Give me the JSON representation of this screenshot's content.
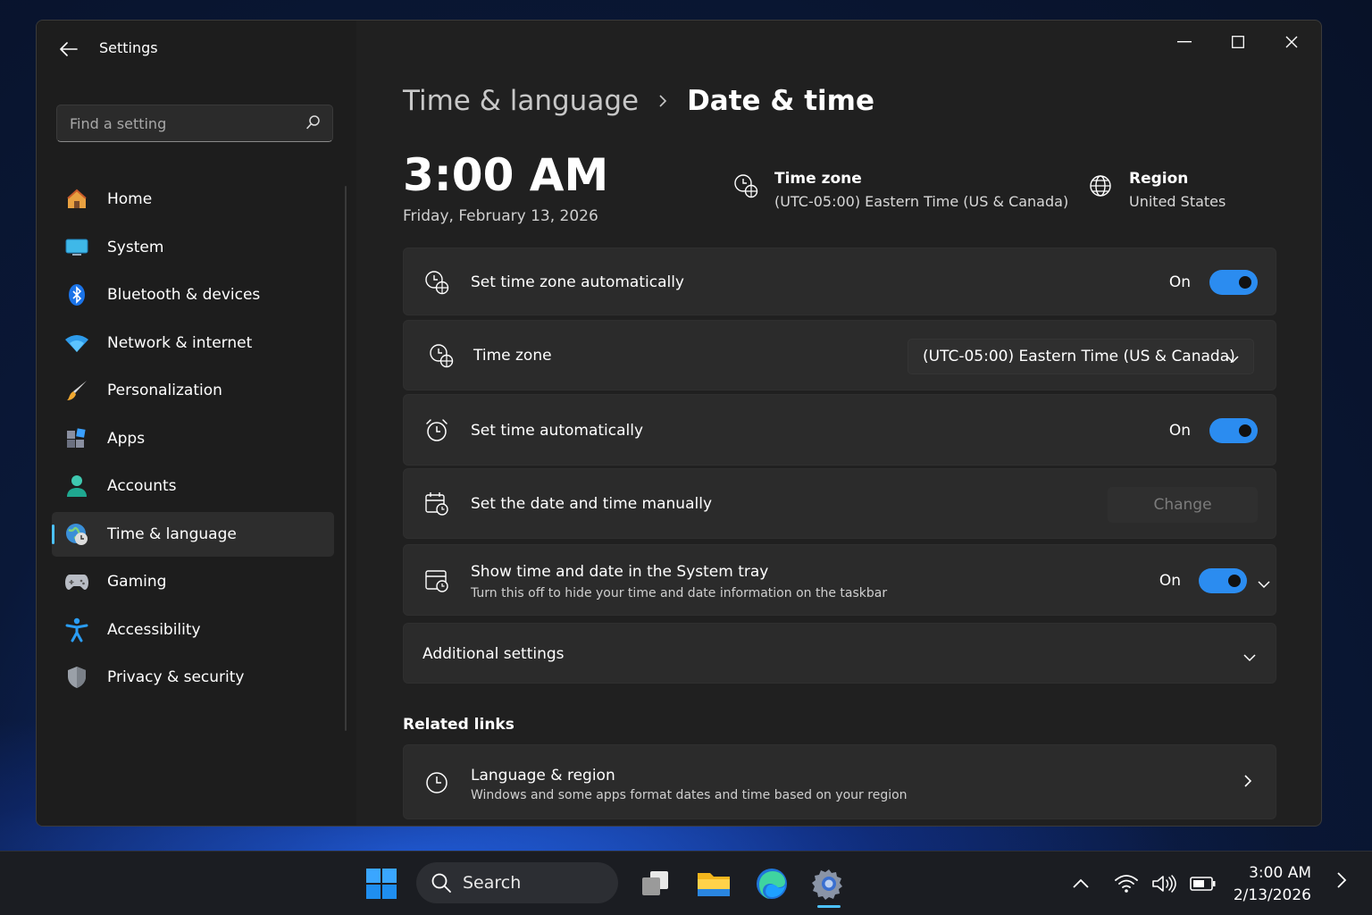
{
  "window": {
    "title": "Settings"
  },
  "search": {
    "placeholder": "Find a setting"
  },
  "sidebar": {
    "items": [
      {
        "label": "Home",
        "icon": "home-icon"
      },
      {
        "label": "System",
        "icon": "system-icon"
      },
      {
        "label": "Bluetooth & devices",
        "icon": "bluetooth-icon"
      },
      {
        "label": "Network & internet",
        "icon": "wifi-icon"
      },
      {
        "label": "Personalization",
        "icon": "brush-icon"
      },
      {
        "label": "Apps",
        "icon": "apps-icon"
      },
      {
        "label": "Accounts",
        "icon": "person-icon"
      },
      {
        "label": "Time & language",
        "icon": "globe-clock-icon",
        "active": true
      },
      {
        "label": "Gaming",
        "icon": "gamepad-icon"
      },
      {
        "label": "Accessibility",
        "icon": "accessibility-icon"
      },
      {
        "label": "Privacy & security",
        "icon": "shield-icon"
      }
    ]
  },
  "breadcrumb": {
    "parent": "Time & language",
    "current": "Date & time"
  },
  "clock": {
    "time": "3:00 AM",
    "date": "Friday, February 13, 2026"
  },
  "summary": {
    "timezone_title": "Time zone",
    "timezone_value": "(UTC-05:00) Eastern Time (US & Canada)",
    "region_title": "Region",
    "region_value": "United States"
  },
  "settings": {
    "auto_timezone": {
      "label": "Set time zone automatically",
      "state": "On"
    },
    "timezone": {
      "label": "Time zone",
      "value": "(UTC-05:00) Eastern Time (US & Canada)"
    },
    "auto_time": {
      "label": "Set time automatically",
      "state": "On"
    },
    "manual": {
      "label": "Set the date and time manually",
      "button": "Change"
    },
    "tray": {
      "label": "Show time and date in the System tray",
      "sub": "Turn this off to hide your time and date information on the taskbar",
      "state": "On"
    },
    "additional": {
      "label": "Additional settings"
    }
  },
  "related": {
    "title": "Related links",
    "language_region": {
      "label": "Language & region",
      "sub": "Windows and some apps format dates and time based on your region"
    }
  },
  "taskbar": {
    "search_label": "Search",
    "time": "3:00 AM",
    "date": "2/13/2026"
  },
  "colors": {
    "accent": "#4cc2ff",
    "toggle_on": "#2b8cf0",
    "window_bg": "#202020",
    "card_bg": "#2b2b2b"
  }
}
